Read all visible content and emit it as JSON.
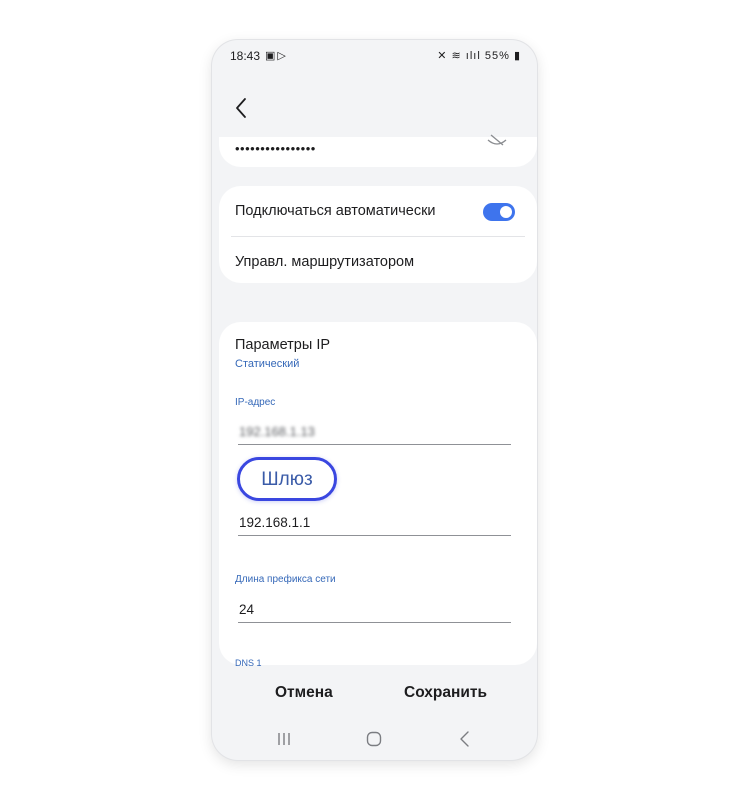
{
  "status_bar": {
    "time": "18:43",
    "notification_icons": [
      "gallery-icon",
      "play-icon"
    ],
    "system_icons": [
      "mute-icon",
      "wifi-icon",
      "signal-icon",
      "signal-icon",
      "battery-icon"
    ],
    "battery": "55%"
  },
  "wifi": {
    "password_masked": "••••••••••••••••",
    "auto_connect_label": "Подключаться автоматически",
    "auto_connect_on": true,
    "router_manage_label": "Управл. маршрутизатором"
  },
  "ip_settings": {
    "title": "Параметры IP",
    "mode": "Статический",
    "ip_label": "IP-адрес",
    "ip_value": "192.168.1.13",
    "gateway_label": "Шлюз",
    "gateway_value": "192.168.1.1",
    "prefix_label": "Длина префикса сети",
    "prefix_value": "24",
    "dns1_label": "DNS 1"
  },
  "actions": {
    "cancel": "Отмена",
    "save": "Сохранить"
  },
  "colors": {
    "accent": "#3e74ed",
    "highlight_border": "#3a47e0",
    "label_blue": "#3568b8",
    "background": "#f3f4f6"
  }
}
